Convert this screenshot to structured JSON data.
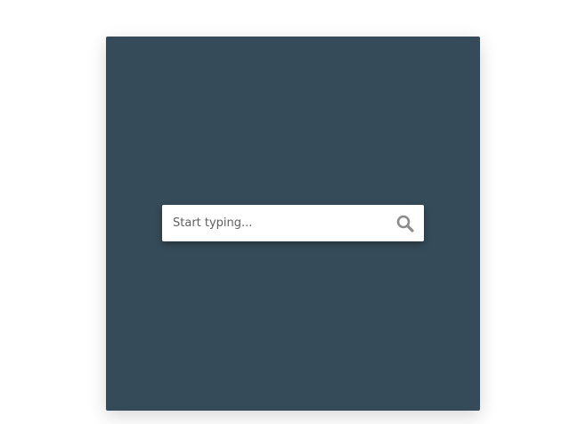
{
  "colors": {
    "page_background": "#ffffff",
    "panel_background": "#364b59",
    "search_box_background": "#ffffff",
    "icon_color": "#8c8c8c"
  },
  "search": {
    "placeholder": "Start typing...",
    "value": "",
    "icon": "search-icon"
  }
}
